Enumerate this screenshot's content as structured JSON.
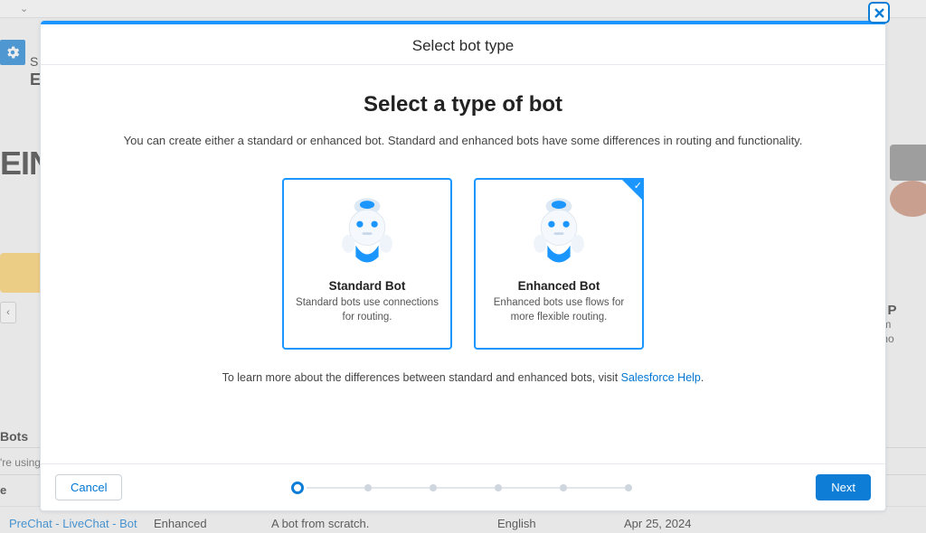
{
  "background": {
    "topbar_label_s": "S",
    "topbar_label_e": "E",
    "ein_big": "EIN",
    "left_arrow": "‹",
    "right_title": "er Bot P",
    "right_line1": "o perform",
    "right_line2": "w, and mo",
    "bots_label": "Bots",
    "using_line": "'re using",
    "e_label": "e",
    "row": {
      "name": "PreChat - LiveChat - Bot",
      "type": "Enhanced",
      "desc": "A bot from scratch.",
      "lang": "English",
      "date": "Apr 25, 2024"
    }
  },
  "modal": {
    "header": "Select bot type",
    "title": "Select a type of bot",
    "subtitle": "You can create either a standard or enhanced bot. Standard and enhanced bots have some differences in routing and functionality.",
    "card_standard": {
      "name": "Standard Bot",
      "desc": "Standard bots use connections for routing."
    },
    "card_enhanced": {
      "name": "Enhanced Bot",
      "desc": "Enhanced bots use flows for more flexible routing."
    },
    "learn_prefix": "To learn more about the differences between standard and enhanced bots, visit ",
    "learn_link": "Salesforce Help",
    "learn_suffix": ".",
    "btn_cancel": "Cancel",
    "btn_next": "Next"
  }
}
